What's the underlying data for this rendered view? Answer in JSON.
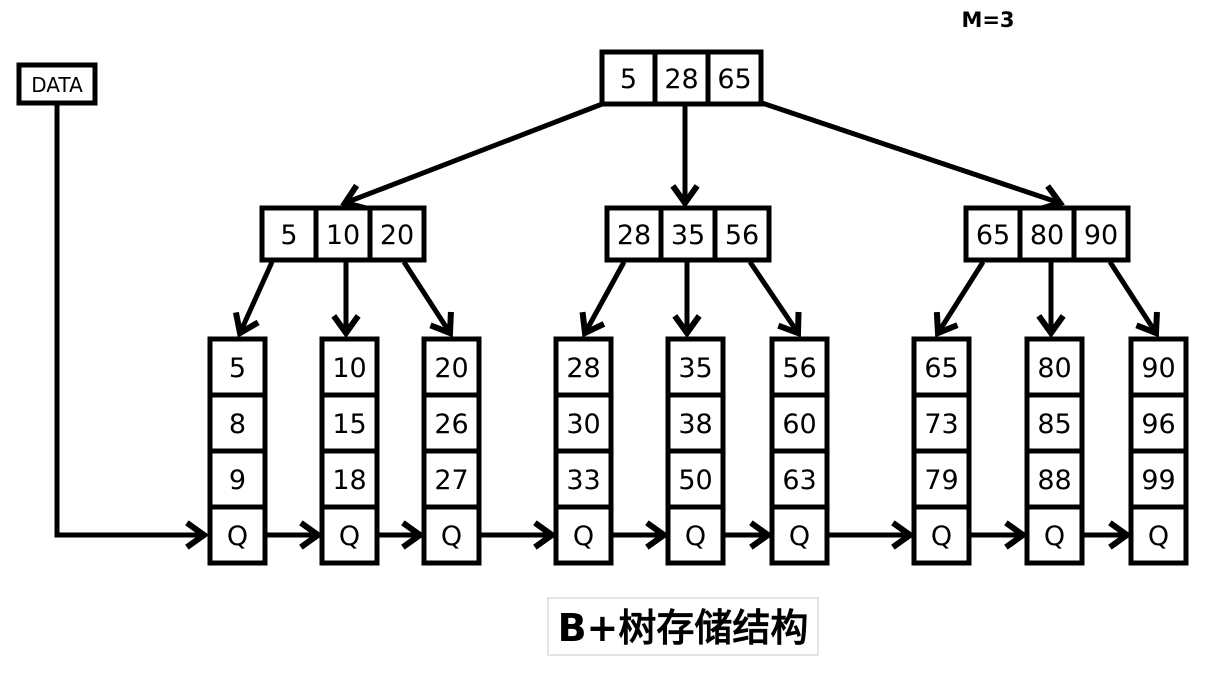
{
  "order_label": "M=3",
  "data_label": "DATA",
  "title": "B+树存储结构",
  "root": {
    "keys": [
      "5",
      "28",
      "65"
    ]
  },
  "internal": [
    {
      "keys": [
        "5",
        "10",
        "20"
      ]
    },
    {
      "keys": [
        "28",
        "35",
        "56"
      ]
    },
    {
      "keys": [
        "65",
        "80",
        "90"
      ]
    }
  ],
  "leaves": [
    {
      "keys": [
        "5",
        "8",
        "9"
      ],
      "pointer": "Q"
    },
    {
      "keys": [
        "10",
        "15",
        "18"
      ],
      "pointer": "Q"
    },
    {
      "keys": [
        "20",
        "26",
        "27"
      ],
      "pointer": "Q"
    },
    {
      "keys": [
        "28",
        "30",
        "33"
      ],
      "pointer": "Q"
    },
    {
      "keys": [
        "35",
        "38",
        "50"
      ],
      "pointer": "Q"
    },
    {
      "keys": [
        "56",
        "60",
        "63"
      ],
      "pointer": "Q"
    },
    {
      "keys": [
        "65",
        "73",
        "79"
      ],
      "pointer": "Q"
    },
    {
      "keys": [
        "80",
        "85",
        "88"
      ],
      "pointer": "Q"
    },
    {
      "keys": [
        "90",
        "96",
        "99"
      ],
      "pointer": "Q"
    }
  ]
}
